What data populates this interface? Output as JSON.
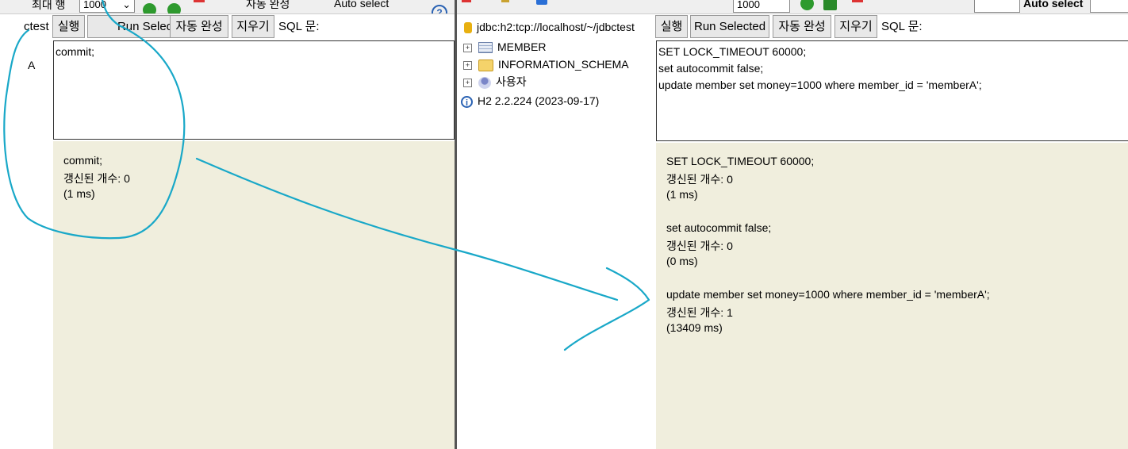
{
  "left": {
    "topbar": {
      "max_rows_label": "최대 행",
      "max_rows_value": "1000",
      "autocomplete_label": "자동 완성",
      "auto_select_label": "Auto select"
    },
    "sidebar": {
      "conn_fragment": "ctest",
      "tree_fragment": "A"
    },
    "toolbar": {
      "run": "실행",
      "run_selected": "Run Selected",
      "autocomplete": "자동 완성",
      "clear": "지우기",
      "sql_label": "SQL 문:"
    },
    "editor": {
      "text": "commit;"
    },
    "results": [
      {
        "sql": "commit;",
        "updated": "갱신된 개수: 0",
        "time": "(1 ms)"
      }
    ]
  },
  "right": {
    "topbar": {
      "max_rows_value": "1000",
      "auto_select_label": "Auto select"
    },
    "connection": "jdbc:h2:tcp://localhost/~/jdbctest",
    "tree": [
      {
        "icon": "table-icon",
        "label": "MEMBER"
      },
      {
        "icon": "folder-icon",
        "label": "INFORMATION_SCHEMA"
      },
      {
        "icon": "users-icon",
        "label": "사용자"
      }
    ],
    "version": "H2 2.2.224 (2023-09-17)",
    "toolbar": {
      "run": "실행",
      "run_selected": "Run Selected",
      "autocomplete": "자동 완성",
      "clear": "지우기",
      "sql_label": "SQL 문:"
    },
    "editor": {
      "lines": [
        "SET LOCK_TIMEOUT 60000;",
        "set autocommit false;",
        "update member set money=1000 where member_id = 'memberA';"
      ]
    },
    "results": [
      {
        "sql": "SET LOCK_TIMEOUT 60000;",
        "updated": "갱신된 개수: 0",
        "time": "(1 ms)"
      },
      {
        "sql": "set autocommit false;",
        "updated": "갱신된 개수: 0",
        "time": "(0 ms)"
      },
      {
        "sql": "update member set money=1000 where member_id = 'memberA';",
        "updated": "갱신된 개수: 1",
        "time": "(13409 ms)"
      }
    ]
  },
  "colors": {
    "annotation": "#19a8c8",
    "result_bg": "#f0eedd"
  }
}
